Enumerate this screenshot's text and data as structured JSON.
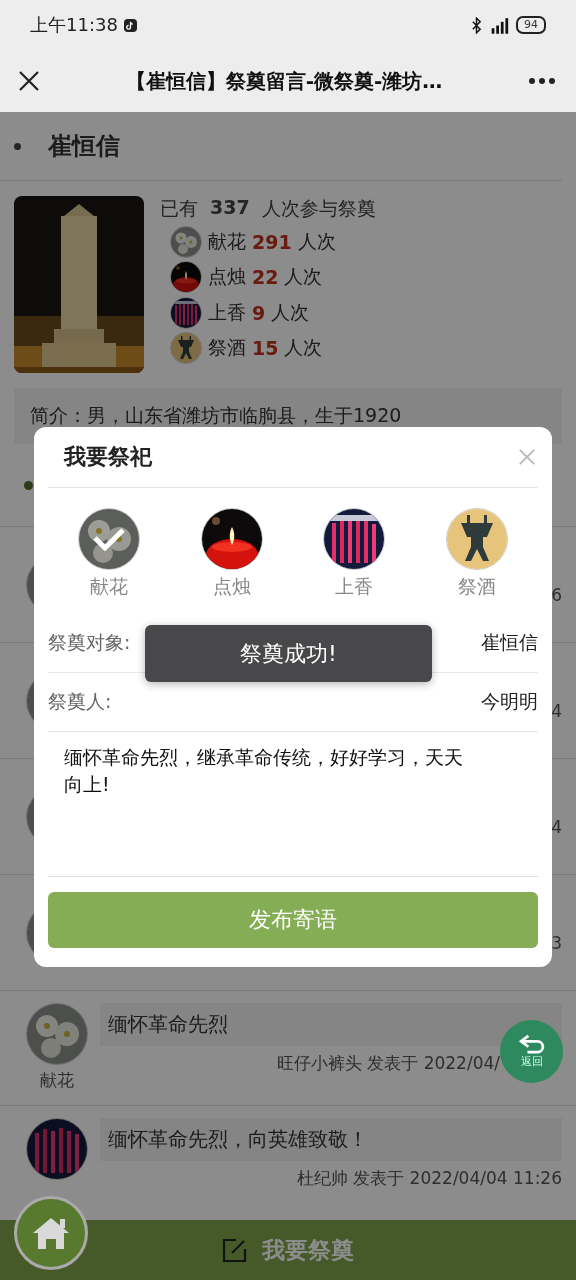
{
  "status_bar": {
    "time": "上午11:38",
    "battery": "94"
  },
  "nav": {
    "title": "【崔恒信】祭奠留言-微祭奠-潍坊…"
  },
  "person": {
    "name": "崔恒信",
    "total_prefix": "已有",
    "total": "337",
    "total_suffix": "人次参与祭奠",
    "stats": [
      {
        "label": "献花",
        "count": "291",
        "unit": "人次"
      },
      {
        "label": "点烛",
        "count": "22",
        "unit": "人次"
      },
      {
        "label": "上香",
        "count": "9",
        "unit": "人次"
      },
      {
        "label": "祭酒",
        "count": "15",
        "unit": "人次"
      }
    ],
    "intro": "简介：男，山东省潍坊市临朐县，生于1920"
  },
  "hidden_rows": [
    {
      "time_tail": "6"
    },
    {
      "time_tail": "4"
    },
    {
      "time_tail": "4"
    },
    {
      "time_tail": "3"
    }
  ],
  "comments": [
    {
      "offering": "献花",
      "message": "缅怀革命先烈",
      "meta": "旺仔小裤头 发表于 2022/04/"
    },
    {
      "message": "缅怀革命先烈，向英雄致敬！",
      "meta": "杜纪帅 发表于 2022/04/04 11:26"
    }
  ],
  "bottom_bar": {
    "label": "我要祭奠"
  },
  "return_button": {
    "label": "返回"
  },
  "dialog": {
    "title": "我要祭祀",
    "offerings": [
      {
        "label": "献花",
        "selected": true
      },
      {
        "label": "点烛",
        "selected": false
      },
      {
        "label": "上香",
        "selected": false
      },
      {
        "label": "祭酒",
        "selected": false
      }
    ],
    "fields": [
      {
        "label": "祭奠对象:",
        "value": "崔恒信"
      },
      {
        "label": "祭奠人:",
        "value": "今明明"
      }
    ],
    "message": "缅怀革命先烈，继承革命传统，好好学习，天天向上!",
    "submit": "发布寄语"
  },
  "toast": "祭奠成功!"
}
